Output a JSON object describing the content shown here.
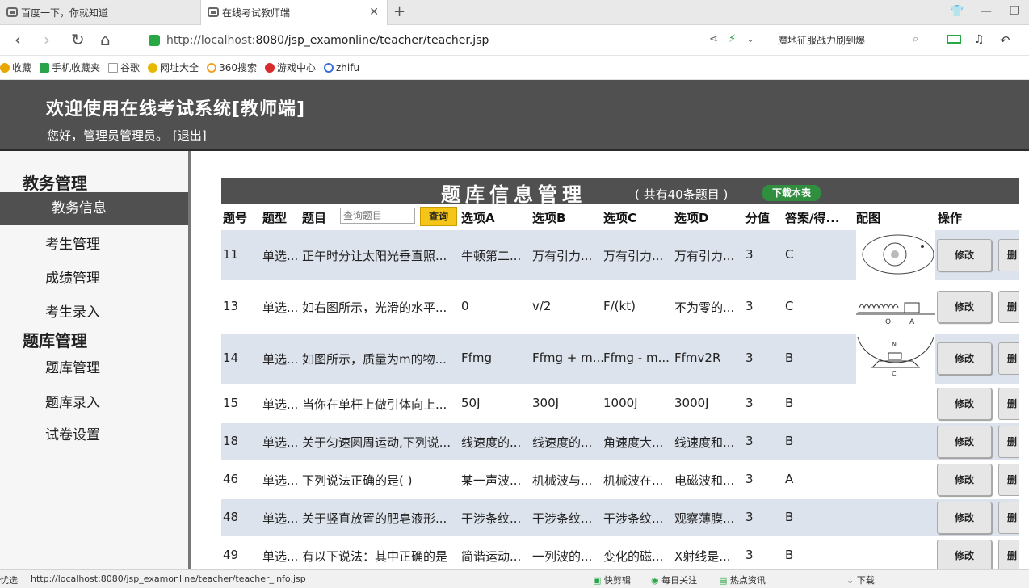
{
  "browser": {
    "tabs": [
      {
        "label": "百度一下，你就知道"
      },
      {
        "label": "在线考试教师端"
      }
    ],
    "url_host": "http://localhost",
    "url_rest": ":8080/jsp_examonline/teacher/teacher.jsp",
    "search_hint": "魔地征服战力刷到爆",
    "bookmarks": [
      {
        "label": "收藏",
        "color": "#e6a700"
      },
      {
        "label": "手机收藏夹",
        "color": "#2aa34a"
      },
      {
        "label": "谷歌",
        "color": "#999999"
      },
      {
        "label": "网址大全",
        "color": "#e6b800"
      },
      {
        "label": "360搜索",
        "color": "#f0a020"
      },
      {
        "label": "游戏中心",
        "color": "#d92b2b"
      },
      {
        "label": "zhifu",
        "color": "#3a6fd8"
      }
    ]
  },
  "header": {
    "title": "欢迎使用在线考试系统[教师端]",
    "greeting": "您好，管理员管理员。",
    "logout": "[退出]"
  },
  "sidebar": {
    "group1": "教务管理",
    "active_item": "教务信息",
    "items1": [
      "考生管理",
      "成绩管理",
      "考生录入"
    ],
    "group2": "题库管理",
    "items2": [
      "题库管理",
      "题库录入",
      "试卷设置"
    ]
  },
  "main": {
    "title": "题库信息管理",
    "count": "( 共有40条题目 )",
    "download": "下载本表",
    "search_placeholder": "查询题目",
    "search_button": "查询",
    "columns": {
      "id": "题号",
      "type": "题型",
      "question": "题目",
      "a": "选项A",
      "b": "选项B",
      "c": "选项C",
      "d": "选项D",
      "score": "分值",
      "answer": "答案/得...",
      "image": "配图",
      "action": "操作"
    },
    "edit_label": "修改",
    "delete_label": "删",
    "rows": [
      {
        "id": "11",
        "type": "单选...",
        "q": "正午时分让太阳光垂直照...",
        "a": "牛顿第二...",
        "b": "万有引力...",
        "c": "万有引力...",
        "d": "万有引力...",
        "score": "3",
        "ans": "C",
        "img": "orbit"
      },
      {
        "id": "13",
        "type": "单选...",
        "q": "如右图所示，光滑的水平...",
        "a": "0",
        "b": "v/2",
        "c": "F/(kt)",
        "d": "不为零的...",
        "score": "3",
        "ans": "C",
        "img": "spring"
      },
      {
        "id": "14",
        "type": "单选...",
        "q": "如图所示，质量为m的物...",
        "a": "Ffmg",
        "b": "Ffmg + m...",
        "c": "Ffmg - m...",
        "d": "Ffmv2R",
        "score": "3",
        "ans": "B",
        "img": "bowl"
      },
      {
        "id": "15",
        "type": "单选...",
        "q": "当你在单杆上做引体向上...",
        "a": "50J",
        "b": "300J",
        "c": "1000J",
        "d": "3000J",
        "score": "3",
        "ans": "B",
        "img": ""
      },
      {
        "id": "18",
        "type": "单选...",
        "q": "关于匀速圆周运动,下列说...",
        "a": "线速度的...",
        "b": "线速度的...",
        "c": "角速度大...",
        "d": "线速度和...",
        "score": "3",
        "ans": "B",
        "img": ""
      },
      {
        "id": "46",
        "type": "单选...",
        "q": "下列说法正确的是( )",
        "a": "某一声波...",
        "b": "机械波与...",
        "c": "机械波在...",
        "d": "电磁波和...",
        "score": "3",
        "ans": "A",
        "img": ""
      },
      {
        "id": "48",
        "type": "单选...",
        "q": "关于竖直放置的肥皂液形...",
        "a": "干涉条纹...",
        "b": "干涉条纹...",
        "c": "干涉条纹...",
        "d": "观察薄膜...",
        "score": "3",
        "ans": "B",
        "img": ""
      },
      {
        "id": "49",
        "type": "单选...",
        "q": "有以下说法：其中正确的是",
        "a": "简谐运动...",
        "b": "一列波的...",
        "c": "变化的磁...",
        "d": "X射线是...",
        "score": "3",
        "ans": "B",
        "img": ""
      }
    ]
  },
  "status": {
    "left": "忧选",
    "url": "http://localhost:8080/jsp_examonline/teacher/teacher_info.jsp",
    "items": [
      "快剪辑",
      "每日关注",
      "热点资讯",
      "下载"
    ]
  }
}
